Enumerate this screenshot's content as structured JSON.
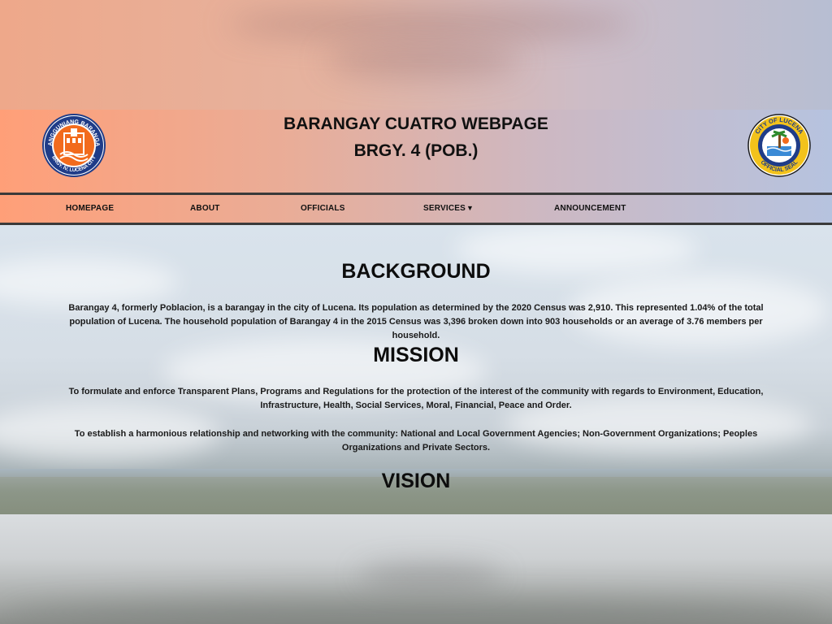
{
  "header": {
    "title": "BARANGAY CUATRO WEBPAGE",
    "subtitle": "BRGY. 4 (POB.)",
    "left_seal": {
      "icon": "barangay-seal-icon",
      "text_top": "SANGGUNIANG BARANGAY",
      "text_bottom": "BRGY. IV, LUCENA CITY",
      "color": "#f26b1d"
    },
    "right_seal": {
      "icon": "city-seal-icon",
      "text_top": "CITY OF LUCENA",
      "text_bottom": "OFFICIAL SEAL",
      "color": "#1f3c88"
    }
  },
  "nav": {
    "items": [
      {
        "label": "HOMEPAGE"
      },
      {
        "label": "ABOUT"
      },
      {
        "label": "OFFICIALS"
      },
      {
        "label": "SERVICES",
        "caret": "▼"
      },
      {
        "label": "ANNOUNCEMENT"
      }
    ]
  },
  "sections": {
    "background": {
      "heading": "BACKGROUND",
      "text": "Barangay 4, formerly Poblacion, is a barangay in the city of Lucena. Its population as determined by the 2020 Census was 2,910. This represented 1.04% of the total population of Lucena. The household population of Barangay 4 in the 2015 Census was 3,396 broken down into 903 households or an average of 3.76 members per household."
    },
    "mission": {
      "heading": "MISSION",
      "paragraphs": [
        "To formulate and enforce Transparent Plans, Programs and Regulations for the protection of the interest of the community with regards to Environment, Education, Infrastructure, Health, Social Services, Moral, Financial, Peace and Order.",
        "To establish a harmonious relationship and networking with the community: National and Local Government Agencies; Non-Government Organizations; Peoples Organizations and Private Sectors."
      ]
    },
    "vision": {
      "heading": "VISION"
    }
  },
  "colors": {
    "header_left": "#ff9f78",
    "header_right": "#b6c3df",
    "nav_border": "#3a3a3a"
  }
}
